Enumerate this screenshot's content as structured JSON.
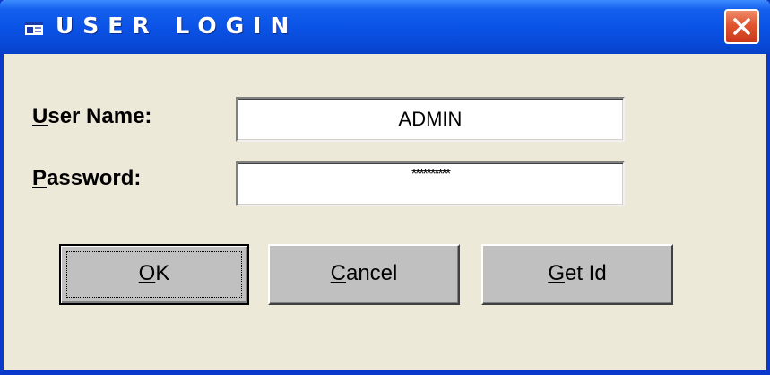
{
  "window": {
    "title": "USER LOGIN",
    "colors": {
      "titlebar": "#0a53e6",
      "close": "#e0552f",
      "face": "#ece9d8"
    }
  },
  "form": {
    "username": {
      "label_accel": "U",
      "label_rest": "ser Name:",
      "value": "ADMIN"
    },
    "password": {
      "label_accel": "P",
      "label_rest": "assword:",
      "value": "**********"
    }
  },
  "buttons": {
    "ok": {
      "accel": "O",
      "rest": "K"
    },
    "cancel": {
      "accel": "C",
      "rest": "ancel"
    },
    "getid": {
      "accel": "G",
      "rest": "et Id"
    }
  },
  "icons": {
    "app": "window-app-icon",
    "close": "close-icon"
  }
}
